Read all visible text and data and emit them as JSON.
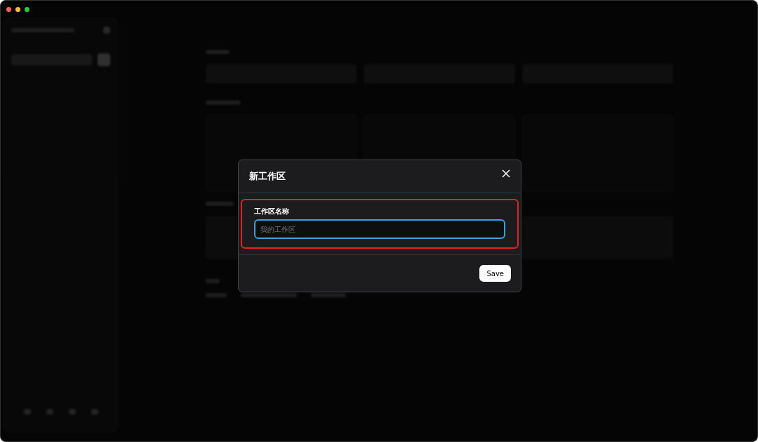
{
  "dialog": {
    "title": "新工作区",
    "field": {
      "label": "工作区名称",
      "placeholder": "我的工作区",
      "highlighted": true,
      "focused": true
    },
    "buttons": [
      {
        "label": "Save",
        "kind": "primary"
      }
    ]
  }
}
